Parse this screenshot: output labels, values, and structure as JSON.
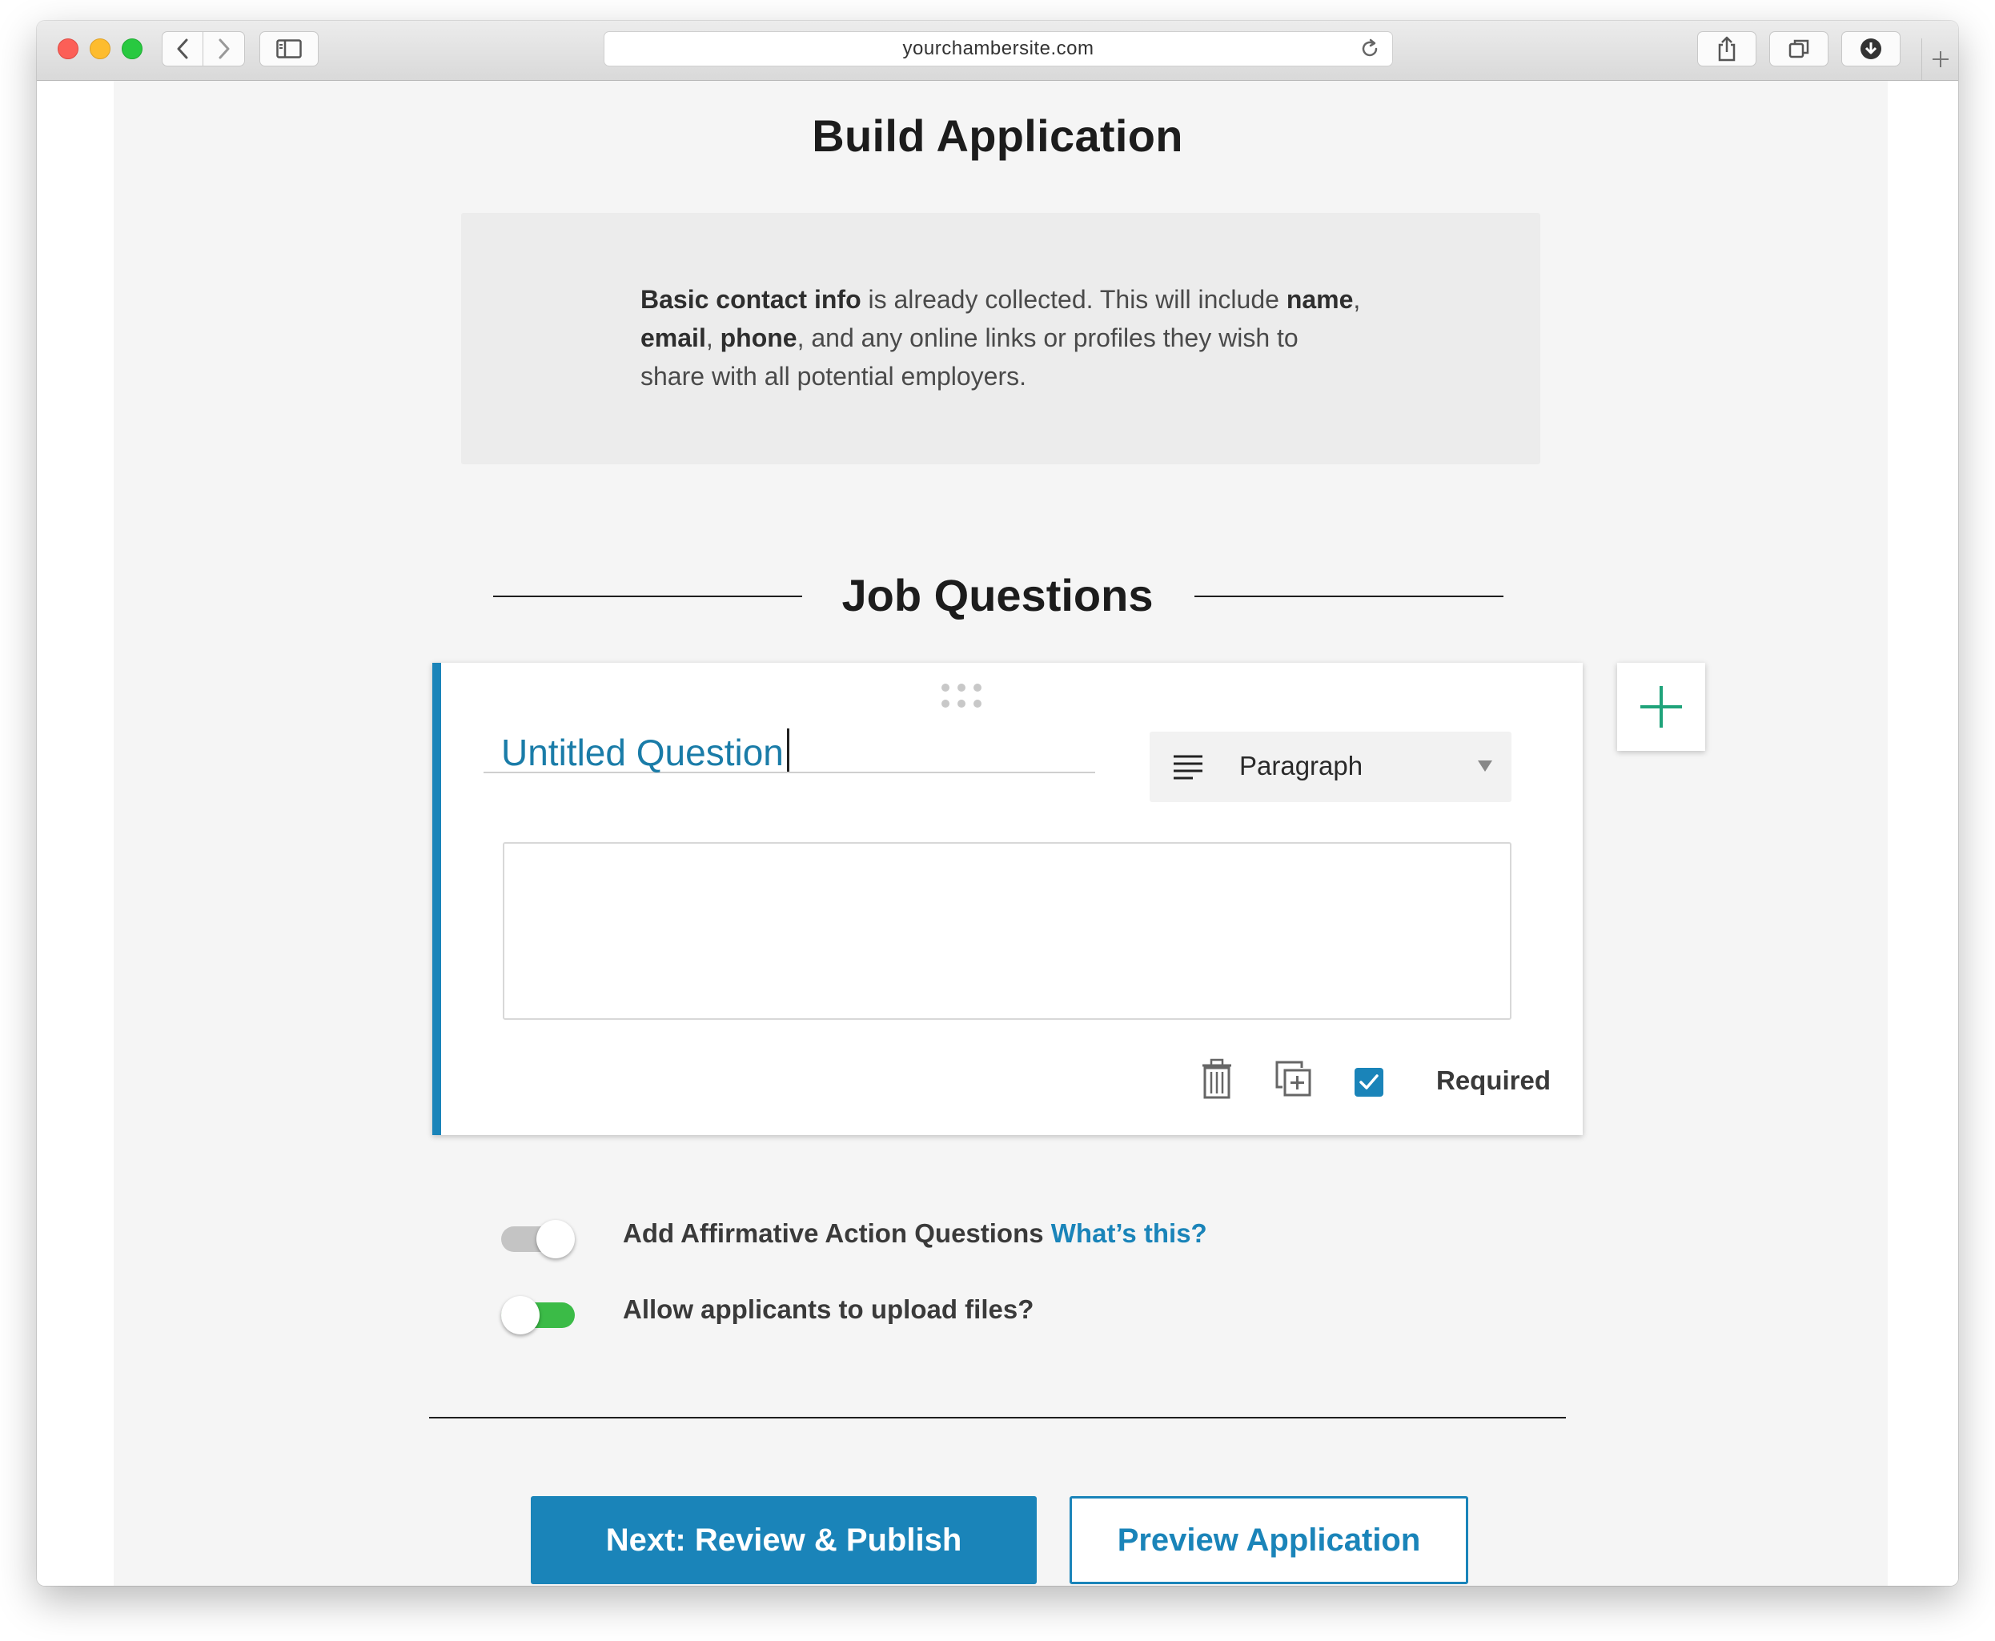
{
  "browser": {
    "url": "yourchambersite.com",
    "icons": {
      "back": "chevron-left-icon",
      "forward": "chevron-right-icon",
      "sidebar": "sidebar-icon",
      "reload": "reload-icon",
      "share": "share-icon",
      "tabs": "tabs-overview-icon",
      "downloads": "download-icon",
      "new_tab": "plus-icon"
    }
  },
  "page": {
    "title": "Build Application"
  },
  "info": {
    "bold_contact": "Basic contact info",
    "text_1": " is already collected. This will include ",
    "bold_name": "name",
    "comma_1": ",",
    "bold_email": "email",
    "comma_2": ", ",
    "bold_phone": "phone",
    "text_2": ", and any online links or profiles they wish to share with all potential employers."
  },
  "section": {
    "title": "Job Questions"
  },
  "question": {
    "title_value": "Untitled Question",
    "type_selected": "Paragraph",
    "required_label": "Required",
    "required_checked": true
  },
  "toggles": [
    {
      "label": "Add Affirmative Action Questions",
      "link": "What’s this?",
      "state": "off"
    },
    {
      "label": "Allow applicants to upload files?",
      "state": "on"
    }
  ],
  "buttons": {
    "next": "Next: Review & Publish",
    "preview": "Preview Application"
  },
  "colors": {
    "accent": "#1a84b9",
    "add_plus": "#1fa37a",
    "toggle_on": "#3bbb47",
    "toggle_off": "#c4c4c4",
    "page_bg": "#f5f5f5"
  }
}
